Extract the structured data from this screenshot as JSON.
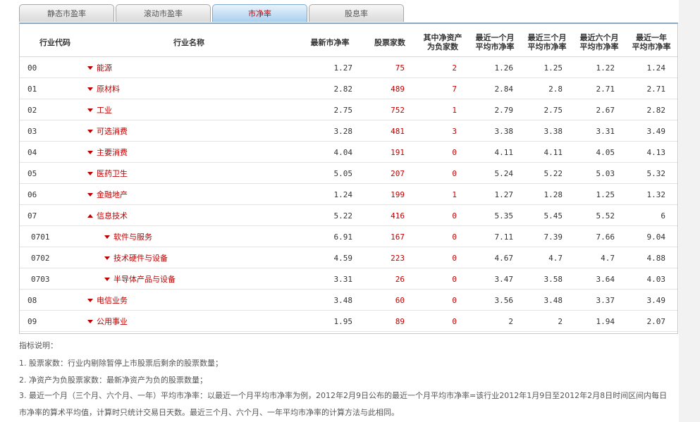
{
  "tabs": [
    {
      "label": "静态市盈率",
      "active": false
    },
    {
      "label": "滚动市盈率",
      "active": false
    },
    {
      "label": "市净率",
      "active": true
    },
    {
      "label": "股息率",
      "active": false
    }
  ],
  "table": {
    "headers": {
      "code": "行业代码",
      "name": "行业名称",
      "latest_pb": "最新市净率",
      "stock_count": "股票家数",
      "neg_count_l1": "其中净资产",
      "neg_count_l2": "为负家数",
      "m1_l1": "最近一个月",
      "m1_l2": "平均市净率",
      "m3_l1": "最近三个月",
      "m3_l2": "平均市净率",
      "m6_l1": "最近六个月",
      "m6_l2": "平均市净率",
      "y1_l1": "最近一年",
      "y1_l2": "平均市净率"
    },
    "rows": [
      {
        "code": "00",
        "name": "能源",
        "expanded": false,
        "level": 1,
        "latest": "1.27",
        "count": "75",
        "neg": "2",
        "m1": "1.26",
        "m3": "1.25",
        "m6": "1.22",
        "y1": "1.24"
      },
      {
        "code": "01",
        "name": "原材料",
        "expanded": false,
        "level": 1,
        "latest": "2.82",
        "count": "489",
        "neg": "7",
        "m1": "2.84",
        "m3": "2.8",
        "m6": "2.71",
        "y1": "2.71"
      },
      {
        "code": "02",
        "name": "工业",
        "expanded": false,
        "level": 1,
        "latest": "2.75",
        "count": "752",
        "neg": "1",
        "m1": "2.79",
        "m3": "2.75",
        "m6": "2.67",
        "y1": "2.82"
      },
      {
        "code": "03",
        "name": "可选消费",
        "expanded": false,
        "level": 1,
        "latest": "3.28",
        "count": "481",
        "neg": "3",
        "m1": "3.38",
        "m3": "3.38",
        "m6": "3.31",
        "y1": "3.49"
      },
      {
        "code": "04",
        "name": "主要消费",
        "expanded": false,
        "level": 1,
        "latest": "4.04",
        "count": "191",
        "neg": "0",
        "m1": "4.11",
        "m3": "4.11",
        "m6": "4.05",
        "y1": "4.13"
      },
      {
        "code": "05",
        "name": "医药卫生",
        "expanded": false,
        "level": 1,
        "latest": "5.05",
        "count": "207",
        "neg": "0",
        "m1": "5.24",
        "m3": "5.22",
        "m6": "5.03",
        "y1": "5.32"
      },
      {
        "code": "06",
        "name": "金融地产",
        "expanded": false,
        "level": 1,
        "latest": "1.24",
        "count": "199",
        "neg": "1",
        "m1": "1.27",
        "m3": "1.28",
        "m6": "1.25",
        "y1": "1.32"
      },
      {
        "code": "07",
        "name": "信息技术",
        "expanded": true,
        "level": 1,
        "latest": "5.22",
        "count": "416",
        "neg": "0",
        "m1": "5.35",
        "m3": "5.45",
        "m6": "5.52",
        "y1": "6"
      },
      {
        "code": "0701",
        "name": "软件与服务",
        "expanded": false,
        "level": 2,
        "latest": "6.91",
        "count": "167",
        "neg": "0",
        "m1": "7.11",
        "m3": "7.39",
        "m6": "7.66",
        "y1": "9.04"
      },
      {
        "code": "0702",
        "name": "技术硬件与设备",
        "expanded": false,
        "level": 2,
        "latest": "4.59",
        "count": "223",
        "neg": "0",
        "m1": "4.67",
        "m3": "4.7",
        "m6": "4.7",
        "y1": "4.88"
      },
      {
        "code": "0703",
        "name": "半导体产品与设备",
        "expanded": false,
        "level": 2,
        "latest": "3.31",
        "count": "26",
        "neg": "0",
        "m1": "3.47",
        "m3": "3.58",
        "m6": "3.64",
        "y1": "4.03"
      },
      {
        "code": "08",
        "name": "电信业务",
        "expanded": false,
        "level": 1,
        "latest": "3.48",
        "count": "60",
        "neg": "0",
        "m1": "3.56",
        "m3": "3.48",
        "m6": "3.37",
        "y1": "3.49"
      },
      {
        "code": "09",
        "name": "公用事业",
        "expanded": false,
        "level": 1,
        "latest": "1.95",
        "count": "89",
        "neg": "0",
        "m1": "2",
        "m3": "2",
        "m6": "1.94",
        "y1": "2.07"
      }
    ]
  },
  "notes": {
    "title": "指标说明：",
    "items": [
      "1. 股票家数：行业内剔除暂停上市股票后剩余的股票数量；",
      "2. 净资产为负股票家数：最新净资产为负的股票数量；",
      "3. 最近一个月（三个月、六个月、一年）平均市净率：以最近一个月平均市净率为例，2012年2月9日公布的最近一个月平均市净率=该行业2012年1月9日至2012年2月8日时间区间内每日市净率的算术平均值，计算时只统计交易日天数。最近三个月、六个月、一年平均市净率的计算方法与此相同。"
    ]
  },
  "colors": {
    "accent_red": "#c00000",
    "tab_active": "#a9cfee"
  }
}
